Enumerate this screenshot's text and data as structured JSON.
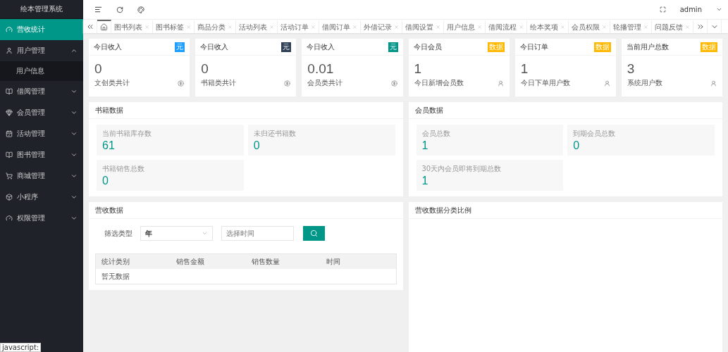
{
  "sidebar": {
    "title": "绘本管理系统",
    "items": [
      {
        "label": "营收统计",
        "selected": true,
        "expanded": false
      },
      {
        "label": "用户管理",
        "selected": false,
        "expanded": true,
        "children": [
          {
            "label": "用户信息",
            "selected": false
          }
        ]
      },
      {
        "label": "借阅管理",
        "selected": false,
        "expanded": false
      },
      {
        "label": "会员管理",
        "selected": false,
        "expanded": false
      },
      {
        "label": "活动管理",
        "selected": false,
        "expanded": false
      },
      {
        "label": "图书管理",
        "selected": false,
        "expanded": false
      },
      {
        "label": "商城管理",
        "selected": false,
        "expanded": false
      },
      {
        "label": "小程序",
        "selected": false,
        "expanded": false
      },
      {
        "label": "权限管理",
        "selected": false,
        "expanded": false
      }
    ]
  },
  "header": {
    "user": "admin"
  },
  "tabs": [
    {
      "kind": "home",
      "selected": true
    },
    {
      "kind": "page",
      "label": "图书列表",
      "selected": false
    },
    {
      "kind": "page",
      "label": "图书标签",
      "selected": false
    },
    {
      "kind": "page",
      "label": "商品分类",
      "selected": false
    },
    {
      "kind": "page",
      "label": "活动列表",
      "selected": false
    },
    {
      "kind": "page",
      "label": "活动订单",
      "selected": false
    },
    {
      "kind": "page",
      "label": "借阅订单",
      "selected": false
    },
    {
      "kind": "page",
      "label": "外借记录",
      "selected": false
    },
    {
      "kind": "page",
      "label": "借阅设置",
      "selected": false
    },
    {
      "kind": "page",
      "label": "用户信息",
      "selected": false
    },
    {
      "kind": "page",
      "label": "借阅流程",
      "selected": false
    },
    {
      "kind": "page",
      "label": "绘本奖项",
      "selected": false
    },
    {
      "kind": "page",
      "label": "会员权限",
      "selected": false
    },
    {
      "kind": "page",
      "label": "轮播管理",
      "selected": false
    },
    {
      "kind": "page",
      "label": "问题反馈",
      "selected": false
    }
  ],
  "stat_cards": [
    {
      "kind": "income",
      "title": "今日收入",
      "badge": "元",
      "color": "#1e9fff",
      "value": "0",
      "caption": "文创类共计"
    },
    {
      "kind": "income",
      "title": "今日收入",
      "badge": "元",
      "color": "#2f4056",
      "value": "0",
      "caption": "书籍类共计"
    },
    {
      "kind": "income",
      "title": "今日收入",
      "badge": "元",
      "color": "#009688",
      "value": "0.01",
      "caption": "会员类共计"
    },
    {
      "kind": "count",
      "title": "今日会员",
      "badge": "数据",
      "color": "#ffb800",
      "value": "1",
      "caption": "今日新增会员数"
    },
    {
      "kind": "count",
      "title": "今日订单",
      "badge": "数据",
      "color": "#ffb800",
      "value": "1",
      "caption": "今日下单用户数"
    },
    {
      "kind": "count",
      "title": "当前用户总数",
      "badge": "数据",
      "color": "#ffb800",
      "value": "3",
      "caption": "系统用户数"
    }
  ],
  "panels": [
    {
      "title": "书籍数据",
      "metrics": [
        {
          "label": "当前书籍库存数",
          "value": "61"
        },
        {
          "label": "未归还书籍数",
          "value": "0"
        },
        {
          "label": "书籍销售总数",
          "value": "0"
        }
      ]
    },
    {
      "title": "会员数据",
      "metrics": [
        {
          "label": "会员总数",
          "value": "1"
        },
        {
          "label": "到期会员总数",
          "value": "0"
        },
        {
          "label": "30天内会员即将到期总数",
          "value": "1"
        }
      ]
    }
  ],
  "revenue": {
    "title": "营收数据",
    "filter_label": "筛选类型",
    "select_value": "年",
    "time_placeholder": "选择时间",
    "columns": [
      "统计类别",
      "销售金额",
      "销售数量",
      "时间"
    ],
    "empty_text": "暂无数据"
  },
  "ratio_panel": {
    "title": "营收数据分类比例"
  },
  "status_bar": "javascript:"
}
